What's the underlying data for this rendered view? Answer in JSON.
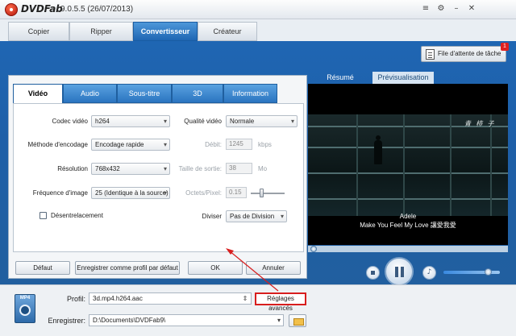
{
  "app": {
    "name": "DVDFab",
    "version": "9.0.5.5 (26/07/2013)"
  },
  "titlebar_icons": [
    "menu-icon",
    "gear-icon",
    "minimize-icon",
    "close-icon"
  ],
  "main_tabs": [
    {
      "label": "Copier",
      "active": false
    },
    {
      "label": "Ripper",
      "active": false
    },
    {
      "label": "Convertisseur",
      "active": true
    },
    {
      "label": "Créateur",
      "active": false
    }
  ],
  "queue": {
    "label": "File d'attente de tâche",
    "badge": "1"
  },
  "settings": {
    "tabs": [
      {
        "label": "Vidéo",
        "active": true
      },
      {
        "label": "Audio",
        "active": false
      },
      {
        "label": "Sous-titre",
        "active": false
      },
      {
        "label": "3D",
        "active": false
      },
      {
        "label": "Information",
        "active": false
      }
    ],
    "codec_label": "Codec vidéo",
    "codec_value": "h264",
    "quality_label": "Qualité vidéo",
    "quality_value": "Normale",
    "encode_label": "Méthode d'encodage",
    "encode_value": "Encodage rapide",
    "bitrate_label": "Débit:",
    "bitrate_value": "1245",
    "bitrate_unit": "kbps",
    "res_label": "Résolution",
    "res_value": "768x432",
    "outsize_label": "Taille de sortie:",
    "outsize_value": "38",
    "outsize_unit": "Mo",
    "fps_label": "Fréquence d'image",
    "fps_value": "25 (Identique à la source)",
    "bpp_label": "Octets/Pixel:",
    "bpp_value": "0.15",
    "deinterlace_label": "Désentrelacement",
    "divide_label": "Diviser",
    "divide_value": "Pas de Division",
    "buttons": {
      "default": "Défaut",
      "save_profile": "Enregistrer comme profil par défaut",
      "ok": "OK",
      "cancel": "Annuler"
    }
  },
  "preview": {
    "tabs": [
      {
        "label": "Résumé",
        "active": false
      },
      {
        "label": "Prévisualisation",
        "active": true
      }
    ],
    "title_text": "青 柿 子",
    "subtitle_1": "Adele",
    "subtitle_2": "Make You Feel My Love 讓愛我愛"
  },
  "bottom": {
    "format_badge": "MP4",
    "profile_label": "Profil:",
    "profile_value": "3d.mp4.h264.aac",
    "advanced_label": "Réglages avancés",
    "save_label": "Enregistrer:",
    "save_path": "D:\\Documents\\DVDFab9\\"
  },
  "colors": {
    "accent_blue": "#1f66b3",
    "highlight_red": "#d81e1e",
    "brand_red": "#b3160c"
  }
}
